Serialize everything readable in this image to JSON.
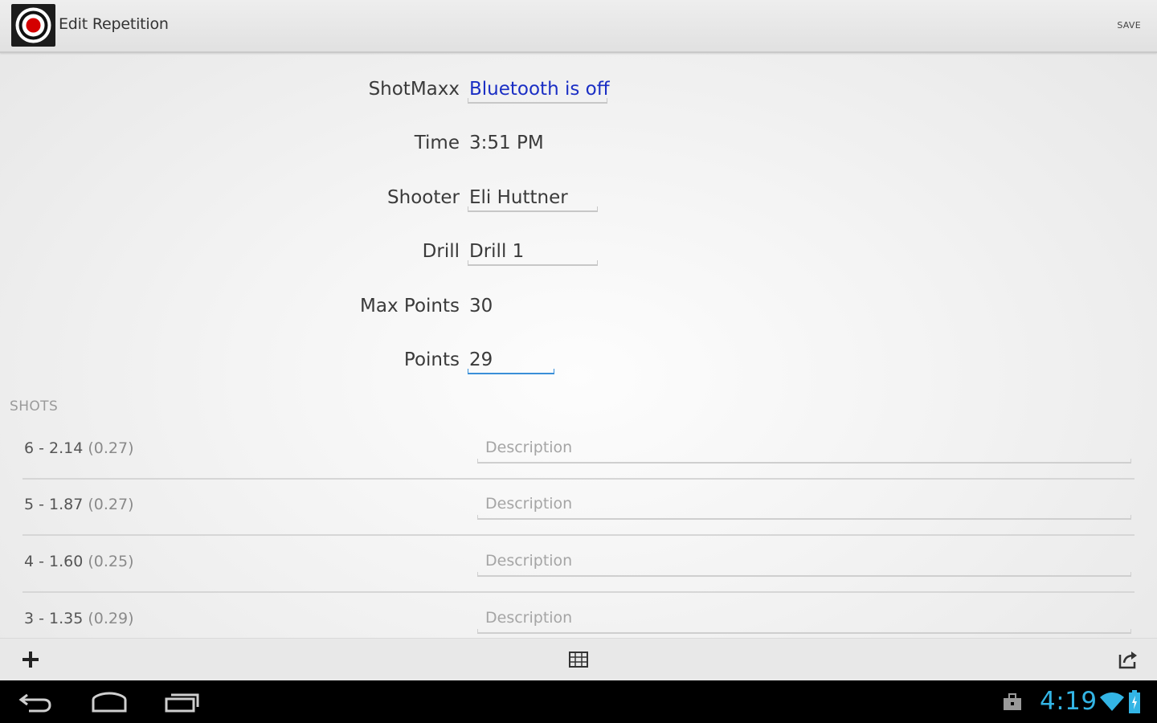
{
  "action_bar": {
    "title": "Edit Repetition",
    "save_label": "SAVE",
    "app_icon": "target-icon"
  },
  "form": {
    "shotmaxx": {
      "label": "ShotMaxx",
      "value": "Bluetooth is off"
    },
    "time": {
      "label": "Time",
      "value": "3:51 PM"
    },
    "shooter": {
      "label": "Shooter",
      "value": "Eli Huttner"
    },
    "drill": {
      "label": "Drill",
      "value": "Drill 1"
    },
    "max_points": {
      "label": "Max Points",
      "value": "30"
    },
    "points": {
      "label": "Points",
      "value": "29"
    }
  },
  "shots": {
    "header": "SHOTS",
    "items": [
      {
        "main": "6 - 2.14",
        "split": "(0.27)",
        "placeholder": "Description"
      },
      {
        "main": "5 - 1.87",
        "split": "(0.27)",
        "placeholder": "Description"
      },
      {
        "main": "4 - 1.60",
        "split": "(0.25)",
        "placeholder": "Description"
      },
      {
        "main": "3 - 1.35",
        "split": "(0.29)",
        "placeholder": "Description"
      }
    ]
  },
  "bottom_bar": {
    "icons": [
      "add-icon",
      "grid-icon",
      "share-icon"
    ]
  },
  "status_bar": {
    "time": "4:19",
    "icons": [
      "briefcase-icon",
      "wifi-icon",
      "battery-icon"
    ]
  },
  "colors": {
    "link": "#1a2ec4",
    "focus": "#3a8fd8",
    "clock": "#33b5e5"
  }
}
